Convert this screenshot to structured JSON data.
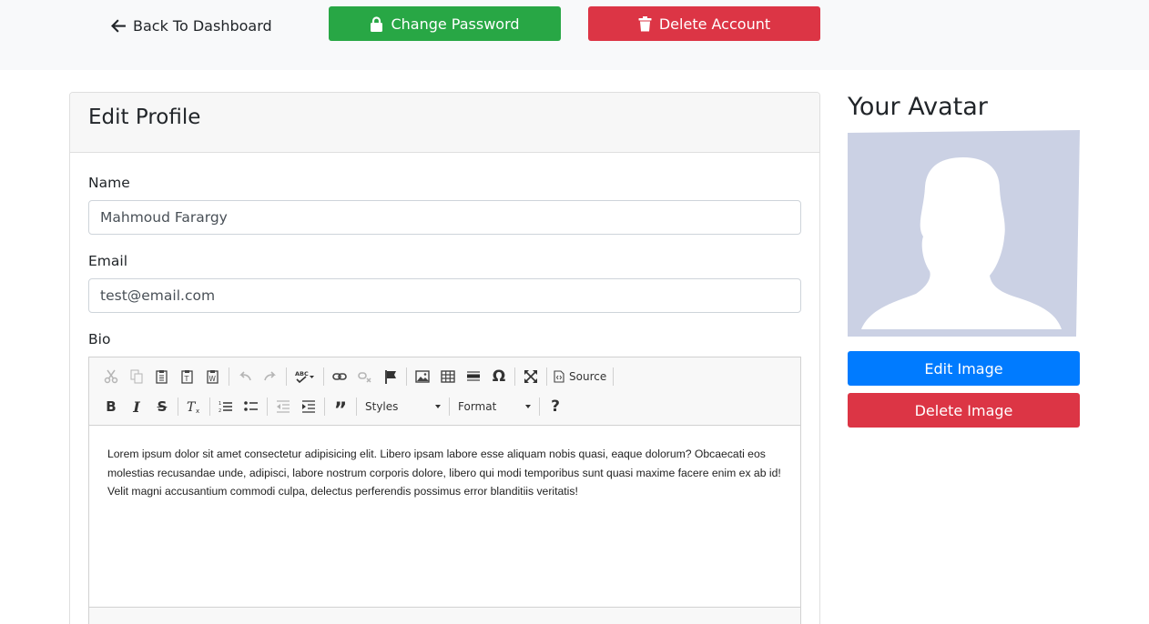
{
  "topbar": {
    "back_label": "Back To Dashboard",
    "change_password_label": "Change Password",
    "delete_account_label": "Delete Account"
  },
  "profile_form": {
    "title": "Edit Profile",
    "name_label": "Name",
    "name_value": "Mahmoud Farargy",
    "email_label": "Email",
    "email_value": "test@email.com",
    "bio_label": "Bio",
    "bio_text": "Lorem ipsum dolor sit amet consectetur adipisicing elit. Libero ipsam labore esse aliquam nobis quasi, eaque dolorum? Obcaecati eos molestias recusandae unde, adipisci, labore nostrum corporis dolore, libero qui modi temporibus sunt quasi maxime facere enim ex ab id! Velit magni accusantium commodi culpa, delectus perferendis possimus error blanditiis veritatis!"
  },
  "editor_toolbar": {
    "source_label": "Source",
    "styles_label": "Styles",
    "format_label": "Format",
    "help_label": "?"
  },
  "avatar": {
    "title": "Your Avatar",
    "edit_label": "Edit Image",
    "delete_label": "Delete Image"
  },
  "colors": {
    "success": "#28a745",
    "danger": "#dc3545",
    "primary": "#007bff",
    "avatar_bg": "#cbd1e4"
  }
}
